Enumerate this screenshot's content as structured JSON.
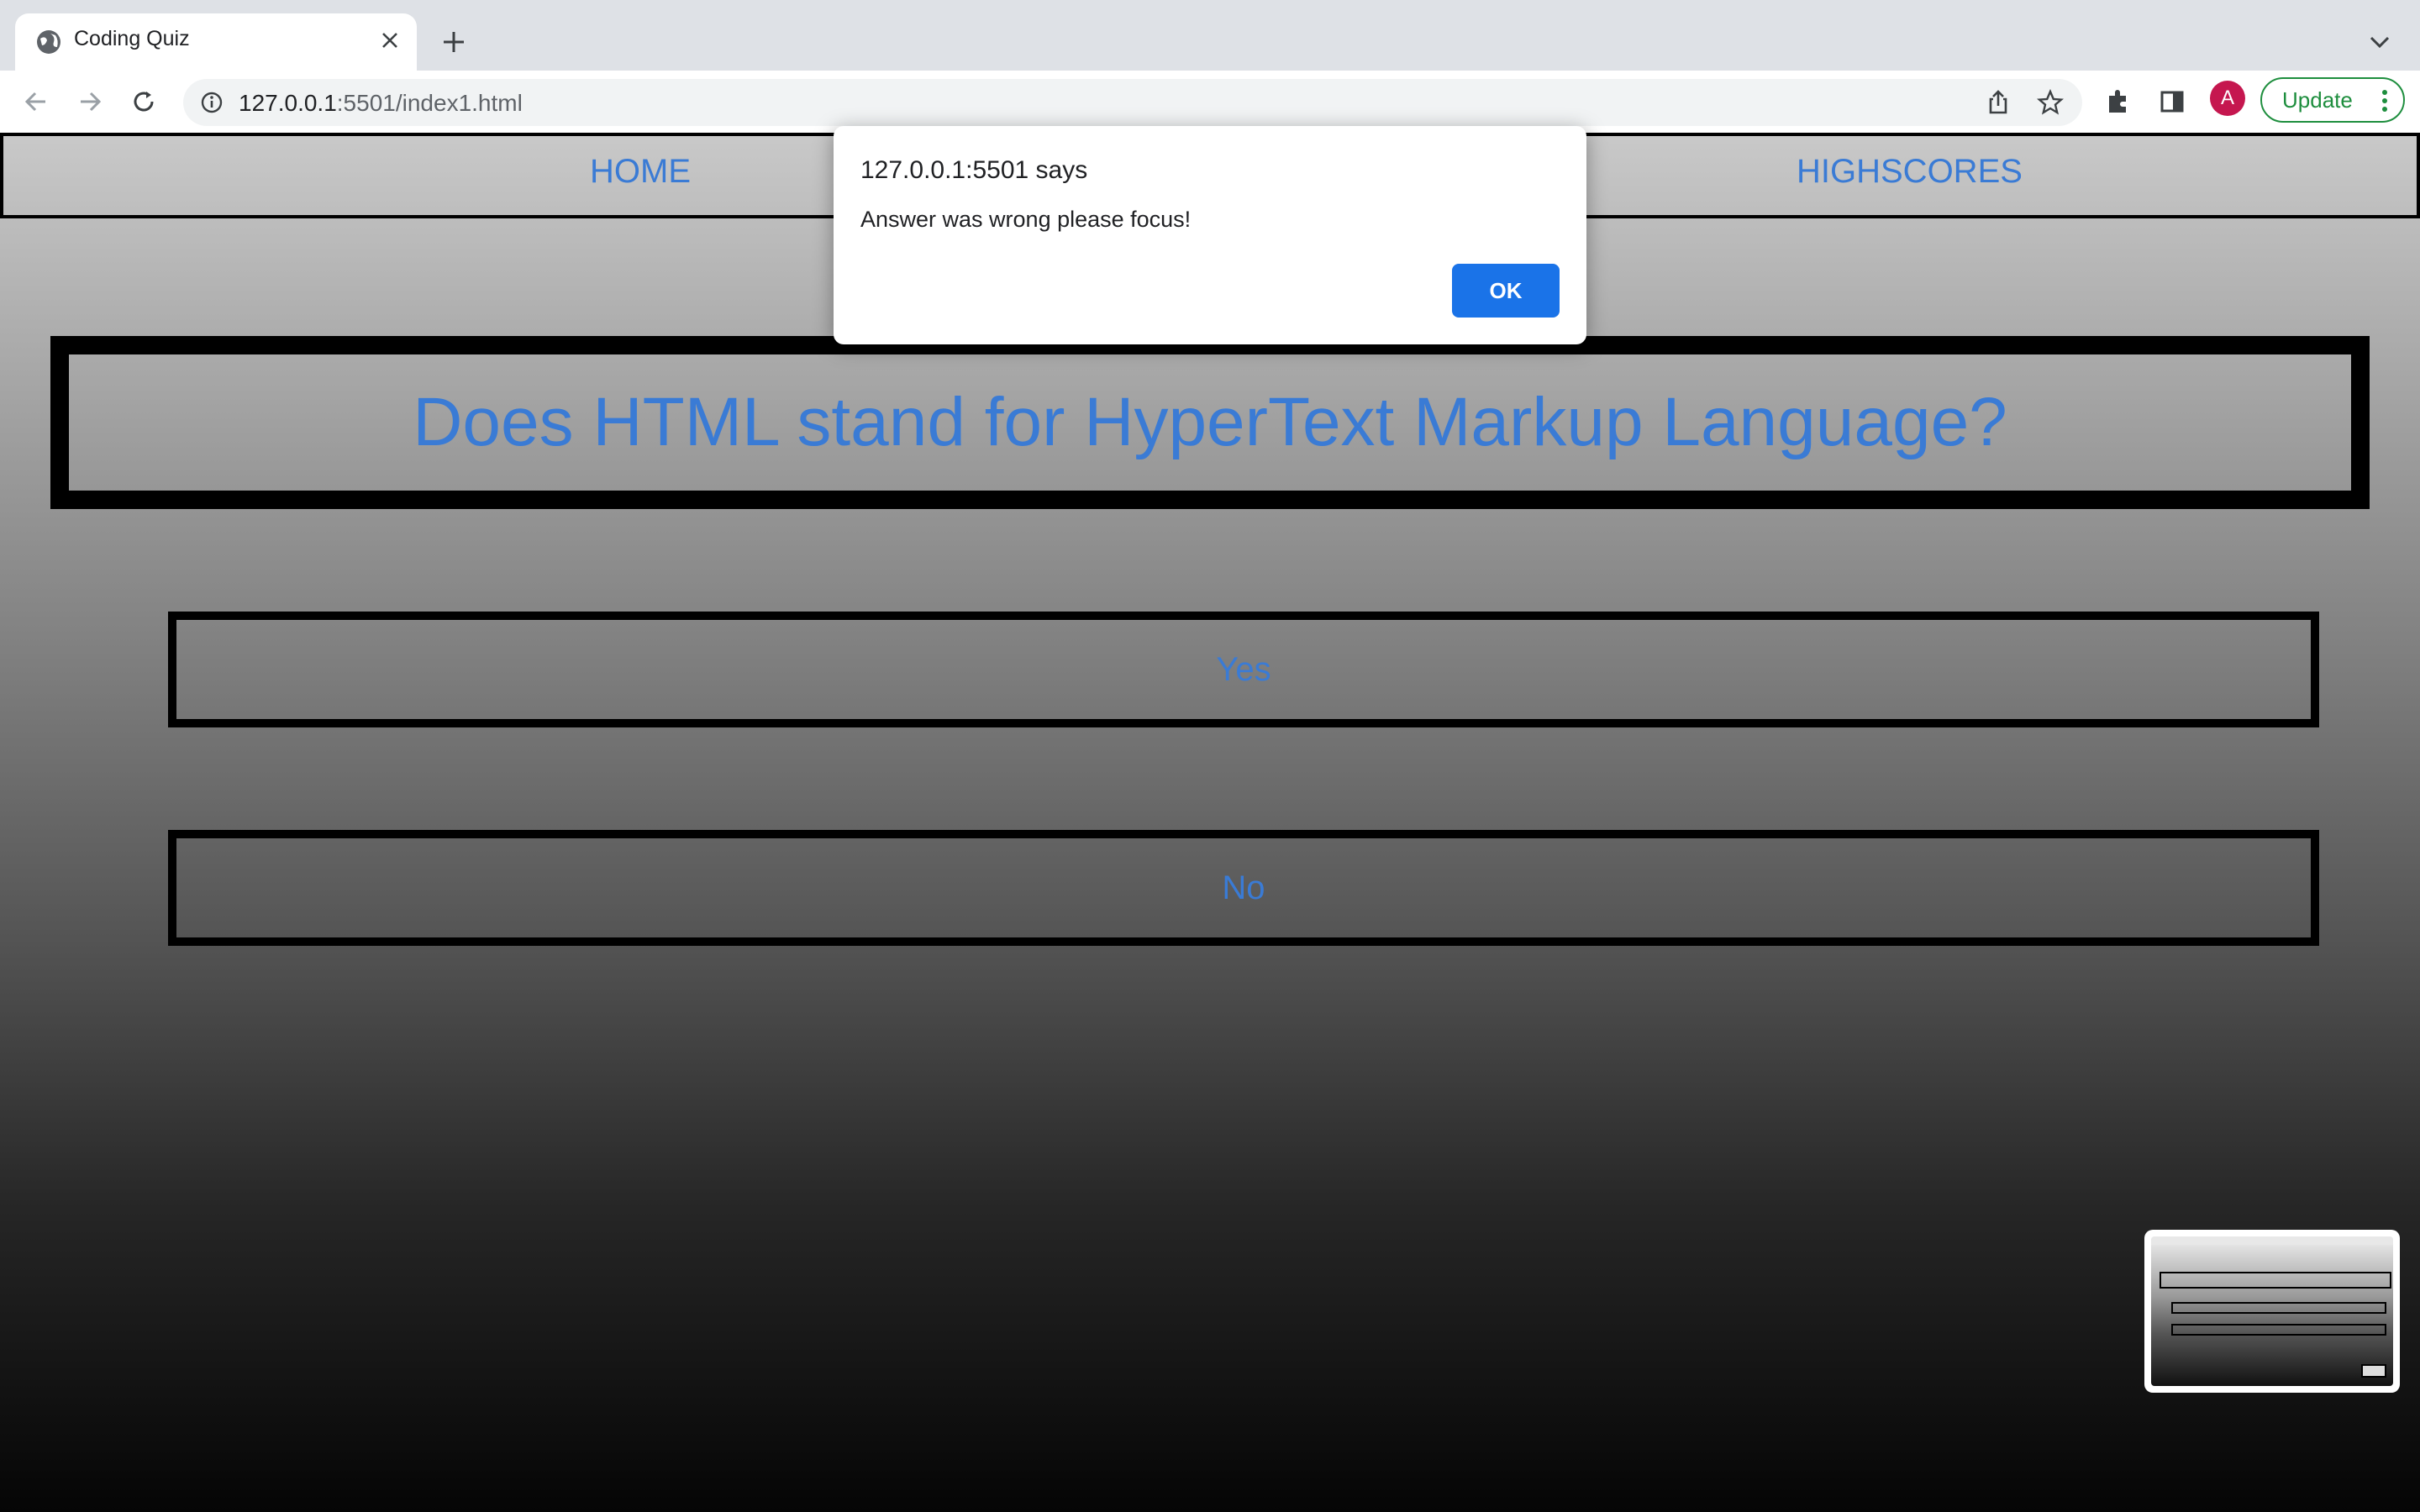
{
  "browser": {
    "tab_title": "Coding Quiz",
    "url_host": "127.0.0.1",
    "url_rest": ":5501/index1.html",
    "profile_initial": "A",
    "update_label": "Update"
  },
  "page": {
    "nav": {
      "home": "HOME",
      "highscores": "HIGHSCORES"
    },
    "question": "Does HTML stand for HyperText Markup Language?",
    "answers": [
      "Yes",
      "No"
    ]
  },
  "dialog": {
    "title": "127.0.0.1:5501 says",
    "message": "Answer was wrong please focus!",
    "ok_label": "OK"
  },
  "colors": {
    "link_blue": "#3a7bd5",
    "dialog_button": "#1a73e8",
    "update_green": "#1e8e3e",
    "avatar": "#c5174f"
  }
}
